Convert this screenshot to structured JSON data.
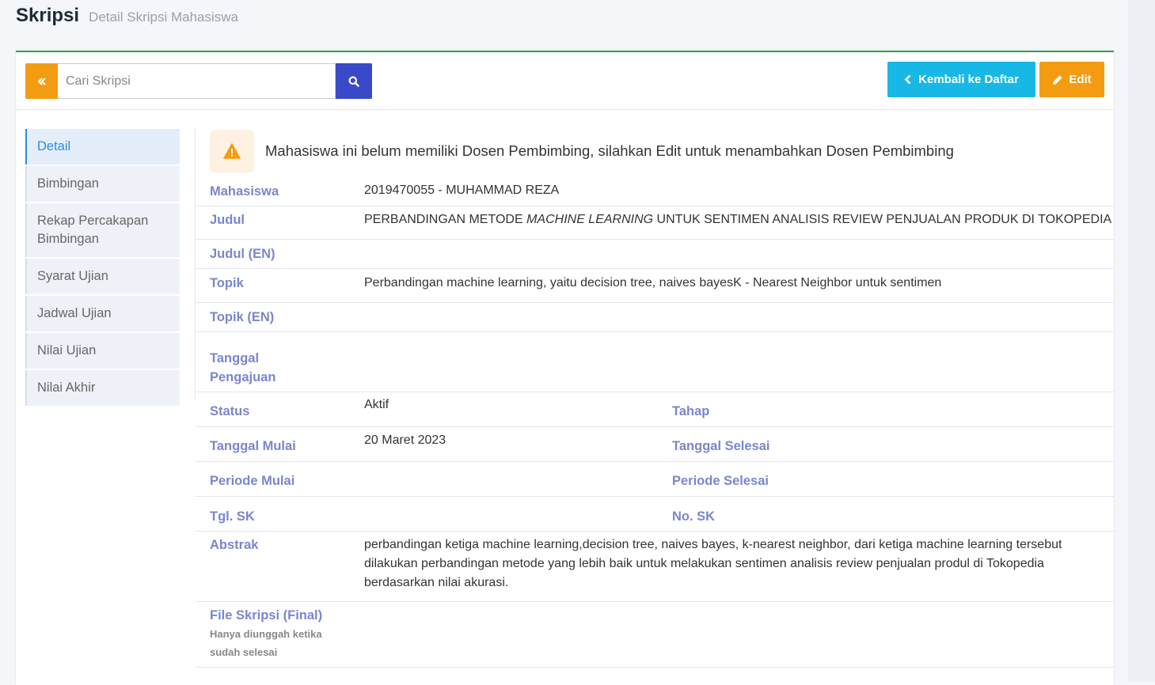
{
  "header": {
    "title": "Skripsi",
    "subtitle": "Detail Skripsi Mahasiswa"
  },
  "toolbar": {
    "back_icon": "double-chevron-left-icon",
    "search_placeholder": "Cari Skripsi",
    "search_icon": "search-icon",
    "kembali_label": "Kembali ke Daftar",
    "kembali_icon": "chevron-left-icon",
    "edit_label": "Edit",
    "edit_icon": "pencil-icon",
    "colors": {
      "orange": "#f39c12",
      "cyan": "#17b8e6",
      "blue": "#3949c8",
      "green": "#28a745"
    }
  },
  "sidebar": {
    "items": [
      {
        "label": "Detail"
      },
      {
        "label": "Bimbingan"
      },
      {
        "label": "Rekap Percakapan Bimbingan"
      },
      {
        "label": "Syarat Ujian"
      },
      {
        "label": "Jadwal Ujian"
      },
      {
        "label": "Nilai Ujian"
      },
      {
        "label": "Nilai Akhir"
      }
    ]
  },
  "alert": {
    "icon": "warning-icon",
    "text": "Mahasiswa ini belum memiliki Dosen Pembimbing, silahkan Edit untuk menambahkan Dosen Pembimbing"
  },
  "fields": {
    "mahasiswa": {
      "label": "Mahasiswa",
      "value": "2019470055 - MUHAMMAD REZA"
    },
    "judul": {
      "label": "Judul",
      "value_before": "PERBANDINGAN METODE ",
      "value_italic": "MACHINE LEARNING",
      "value_after": " UNTUK SENTIMEN ANALISIS REVIEW PENJUALAN PRODUK DI TOKOPEDIA"
    },
    "judul_en": {
      "label": "Judul (EN)",
      "value": ""
    },
    "topik": {
      "label": "Topik",
      "value": "Perbandingan machine learning, yaitu decision tree, naives bayesK - Nearest Neighbor untuk sentimen"
    },
    "topik_en": {
      "label": "Topik (EN)",
      "value": ""
    },
    "tanggal_pengajuan": {
      "label": "Tanggal Pengajuan",
      "value": ""
    },
    "status": {
      "label": "Status",
      "value": "Aktif"
    },
    "tahap": {
      "label": "Tahap",
      "value": ""
    },
    "tanggal_mulai": {
      "label": "Tanggal Mulai",
      "value": "20 Maret 2023"
    },
    "tanggal_selesai": {
      "label": "Tanggal Selesai",
      "value": ""
    },
    "periode_mulai": {
      "label": "Periode Mulai",
      "value": ""
    },
    "periode_selesai": {
      "label": "Periode Selesai",
      "value": ""
    },
    "tgl_sk": {
      "label": "Tgl. SK",
      "value": ""
    },
    "no_sk": {
      "label": "No. SK",
      "value": ""
    },
    "abstrak": {
      "label": "Abstrak",
      "value": "perbandingan ketiga machine learning,decision tree, naives bayes, k-nearest neighbor, dari ketiga machine learning tersebut dilakukan perbandingan metode yang lebih baik untuk melakukan sentimen analisis review penjualan produl di Tokopedia berdasarkan nilai akurasi."
    },
    "file_skripsi": {
      "label": "File Skripsi (Final)",
      "hint": "Hanya diunggah ketika sudah selesai",
      "value": ""
    }
  }
}
